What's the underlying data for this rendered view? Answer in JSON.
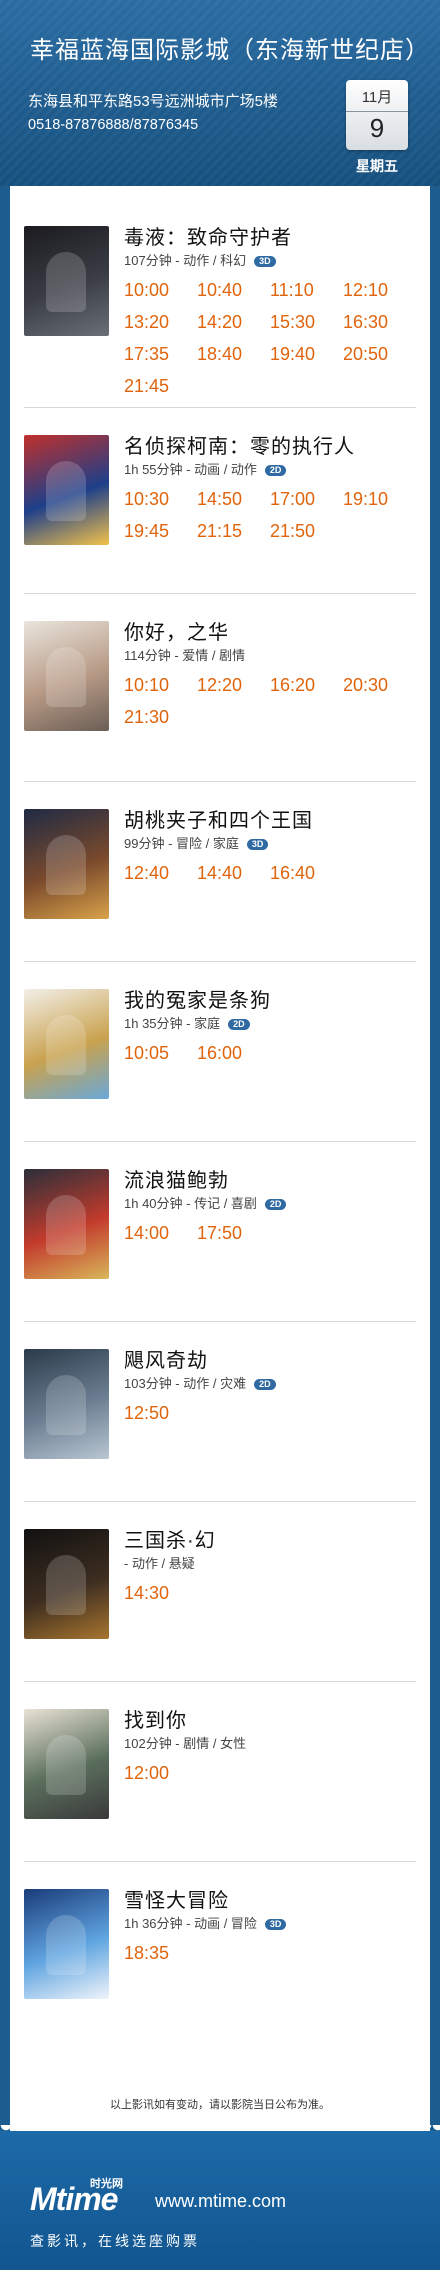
{
  "header": {
    "cinema_name": "幸福蓝海国际影城（东海新世纪店）",
    "address": "东海县和平东路53号远洲城市广场5楼",
    "phone": "0518-87876888/87876345",
    "month": "11月",
    "day": "9",
    "weekday": "星期五"
  },
  "movies": [
    {
      "title": "毒液：致命守护者",
      "meta": "107分钟 - 动作 / 科幻",
      "format": "3D",
      "times": [
        "10:00",
        "10:40",
        "11:10",
        "12:10",
        "13:20",
        "14:20",
        "15:30",
        "16:30",
        "17:35",
        "18:40",
        "19:40",
        "20:50",
        "21:45"
      ]
    },
    {
      "title": "名侦探柯南：零的执行人",
      "meta": "1h 55分钟 - 动画 / 动作",
      "format": "2D",
      "times": [
        "10:30",
        "14:50",
        "17:00",
        "19:10",
        "19:45",
        "21:15",
        "21:50"
      ]
    },
    {
      "title": "你好，之华",
      "meta": "114分钟 - 爱情 / 剧情",
      "format": "",
      "times": [
        "10:10",
        "12:20",
        "16:20",
        "20:30",
        "21:30"
      ]
    },
    {
      "title": "胡桃夹子和四个王国",
      "meta": "99分钟 - 冒险 / 家庭",
      "format": "3D",
      "times": [
        "12:40",
        "14:40",
        "16:40"
      ]
    },
    {
      "title": "我的冤家是条狗",
      "meta": "1h 35分钟 - 家庭",
      "format": "2D",
      "times": [
        "10:05",
        "16:00"
      ]
    },
    {
      "title": "流浪猫鲍勃",
      "meta": "1h 40分钟 - 传记 / 喜剧",
      "format": "2D",
      "times": [
        "14:00",
        "17:50"
      ]
    },
    {
      "title": "飓风奇劫",
      "meta": "103分钟 - 动作 / 灾难",
      "format": "2D",
      "times": [
        "12:50"
      ]
    },
    {
      "title": "三国杀·幻",
      "meta": " - 动作 / 悬疑",
      "format": "",
      "times": [
        "14:30"
      ]
    },
    {
      "title": "找到你",
      "meta": "102分钟 - 剧情 / 女性",
      "format": "",
      "times": [
        "12:00"
      ]
    },
    {
      "title": "雪怪大冒险",
      "meta": "1h 36分钟 - 动画 / 冒险",
      "format": "3D",
      "times": [
        "18:35"
      ]
    }
  ],
  "notice": "以上影讯如有变动，请以影院当日公布为准。",
  "footer": {
    "logo": "Mtime",
    "logo_cn": "时光网",
    "site": "www.mtime.com",
    "slogan": "查影讯，在线选座购票"
  },
  "colors": {
    "header_bg": "#1d5c8e",
    "showtime": "#e0640c",
    "badge": "#2f6aa3"
  }
}
